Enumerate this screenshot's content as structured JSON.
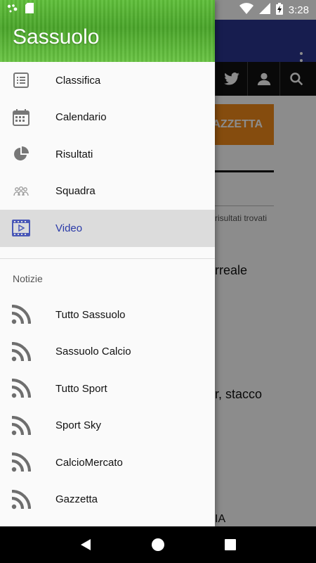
{
  "status_bar": {
    "time": "3:28",
    "icons": [
      "assistant-icon",
      "sd-card-icon",
      "wifi-icon",
      "signal-icon",
      "battery-charging-icon"
    ]
  },
  "background": {
    "button_text": "AZZETTA",
    "results_text": "risultati trovati",
    "line1": "rreale",
    "line2": "r, stacco",
    "line3": "IA",
    "toolbar_icons": [
      "twitter-icon",
      "user-icon",
      "search-icon"
    ]
  },
  "drawer": {
    "title": "Sassuolo",
    "menu": [
      {
        "label": "Classifica",
        "icon": "list-icon"
      },
      {
        "label": "Calendario",
        "icon": "calendar-icon"
      },
      {
        "label": "Risultati",
        "icon": "pie-chart-icon"
      },
      {
        "label": "Squadra",
        "icon": "team-icon"
      },
      {
        "label": "Video",
        "icon": "video-icon",
        "active": true
      }
    ],
    "section_title": "Notizie",
    "news": [
      {
        "label": "Tutto Sassuolo",
        "icon": "rss-icon"
      },
      {
        "label": "Sassuolo Calcio",
        "icon": "rss-icon"
      },
      {
        "label": "Tutto Sport",
        "icon": "rss-icon"
      },
      {
        "label": "Sport Sky",
        "icon": "rss-icon"
      },
      {
        "label": "CalcioMercato",
        "icon": "rss-icon"
      },
      {
        "label": "Gazzetta",
        "icon": "rss-icon"
      }
    ]
  },
  "colors": {
    "app_bar": "#2a3590",
    "active_label": "#2a3aa8",
    "accent_button": "#f28a1a"
  }
}
